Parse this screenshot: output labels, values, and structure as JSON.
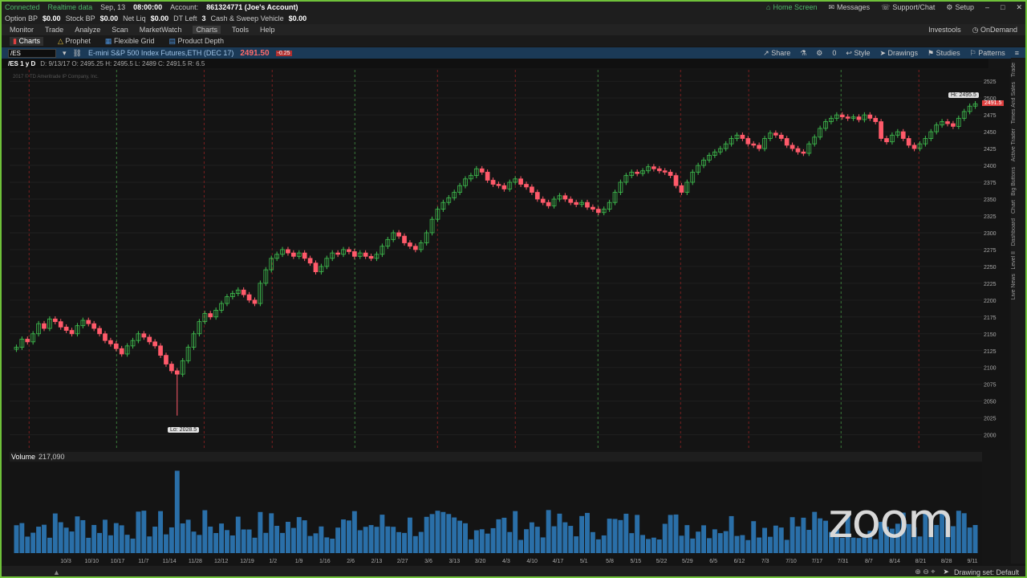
{
  "status": {
    "connected": "Connected",
    "realtime": "Realtime data",
    "date": "Sep, 13",
    "time": "08:00:00",
    "account_label": "Account:",
    "account": "861324771 (Joe's Account)",
    "home": "Home Screen",
    "messages": "Messages",
    "support": "Support/Chat",
    "setup": "Setup"
  },
  "bp": {
    "option_bp_label": "Option BP",
    "option_bp": "$0.00",
    "stock_bp_label": "Stock BP",
    "stock_bp": "$0.00",
    "net_liq_label": "Net Liq",
    "net_liq": "$0.00",
    "dt_left_label": "DT Left",
    "dt_left": "3",
    "cash_label": "Cash & Sweep Vehicle",
    "cash": "$0.00"
  },
  "menu": [
    "Monitor",
    "Trade",
    "Analyze",
    "Scan",
    "MarketWatch",
    "Charts",
    "Tools",
    "Help"
  ],
  "menu_right": [
    "Investools",
    "OnDemand"
  ],
  "subtabs": [
    "Charts",
    "Prophet",
    "Flexible Grid",
    "Product Depth"
  ],
  "symbol": {
    "ticker": "/ES",
    "name": "E-mini S&P 500 Index Futures,ETH (DEC 17)",
    "price": "2491.50",
    "change": "-0.25",
    "tools": [
      "Share",
      "Style",
      "Drawings",
      "Studies",
      "Patterns"
    ],
    "zero": "0"
  },
  "info": {
    "period": "/ES 1 y D",
    "values": "D: 9/13/17   O: 2495.25   H: 2495.5   L: 2489   C: 2491.5   R: 6.5"
  },
  "copyright": "2017 © TD Ameritrade IP Company, Inc.",
  "volume": {
    "label": "Volume",
    "value": "217,090"
  },
  "bottom": {
    "drawing_set": "Drawing set: Default"
  },
  "sidebar": [
    "Trade",
    "Times And Sales",
    "Active Trader",
    "Big Buttons",
    "Chart",
    "Dashboard",
    "Level II",
    "Live News"
  ],
  "watermark": "zoom",
  "chart_data": {
    "type": "candlestick",
    "ylim": [
      1990,
      2530
    ],
    "y_ticks": [
      2000,
      2025,
      2050,
      2075,
      2100,
      2125,
      2150,
      2175,
      2200,
      2225,
      2250,
      2275,
      2300,
      2325,
      2350,
      2375,
      2400,
      2425,
      2450,
      2475,
      2500,
      2525
    ],
    "x_ticks": [
      "10/3",
      "10/10",
      "10/17",
      "11/7",
      "11/14",
      "11/28",
      "12/12",
      "12/19",
      "1/2",
      "1/9",
      "1/16",
      "2/6",
      "2/13",
      "2/27",
      "3/6",
      "3/13",
      "3/20",
      "4/3",
      "4/10",
      "4/17",
      "5/1",
      "5/8",
      "5/15",
      "5/22",
      "5/29",
      "6/5",
      "6/12",
      "7/3",
      "7/10",
      "7/17",
      "7/31",
      "8/7",
      "8/14",
      "8/21",
      "8/28",
      "9/11"
    ],
    "high_label": "Hi: 2495.5",
    "low_label": "Lo: 2028.5",
    "price_label": "2491.5",
    "closes": [
      2130,
      2142,
      2138,
      2150,
      2165,
      2158,
      2172,
      2168,
      2160,
      2155,
      2150,
      2162,
      2170,
      2165,
      2158,
      2150,
      2140,
      2135,
      2128,
      2120,
      2132,
      2140,
      2150,
      2145,
      2138,
      2132,
      2118,
      2105,
      2095,
      2090,
      2110,
      2130,
      2150,
      2168,
      2180,
      2175,
      2185,
      2195,
      2205,
      2210,
      2215,
      2208,
      2200,
      2195,
      2225,
      2245,
      2262,
      2268,
      2275,
      2270,
      2265,
      2270,
      2262,
      2255,
      2242,
      2250,
      2262,
      2270,
      2268,
      2275,
      2272,
      2265,
      2270,
      2265,
      2262,
      2268,
      2280,
      2290,
      2300,
      2295,
      2285,
      2280,
      2275,
      2285,
      2300,
      2320,
      2335,
      2345,
      2352,
      2360,
      2370,
      2380,
      2385,
      2395,
      2390,
      2378,
      2372,
      2370,
      2365,
      2375,
      2380,
      2372,
      2368,
      2360,
      2350,
      2345,
      2340,
      2350,
      2355,
      2350,
      2345,
      2342,
      2345,
      2338,
      2335,
      2330,
      2335,
      2345,
      2360,
      2375,
      2385,
      2390,
      2388,
      2392,
      2398,
      2395,
      2392,
      2390,
      2385,
      2370,
      2360,
      2375,
      2390,
      2400,
      2408,
      2415,
      2420,
      2425,
      2432,
      2440,
      2445,
      2440,
      2432,
      2430,
      2425,
      2440,
      2448,
      2445,
      2440,
      2430,
      2425,
      2420,
      2418,
      2432,
      2442,
      2455,
      2465,
      2470,
      2475,
      2472,
      2470,
      2472,
      2468,
      2475,
      2470,
      2465,
      2440,
      2435,
      2445,
      2450,
      2440,
      2430,
      2425,
      2432,
      2440,
      2450,
      2460,
      2465,
      2462,
      2458,
      2470,
      2480,
      2488,
      2491.5
    ]
  }
}
